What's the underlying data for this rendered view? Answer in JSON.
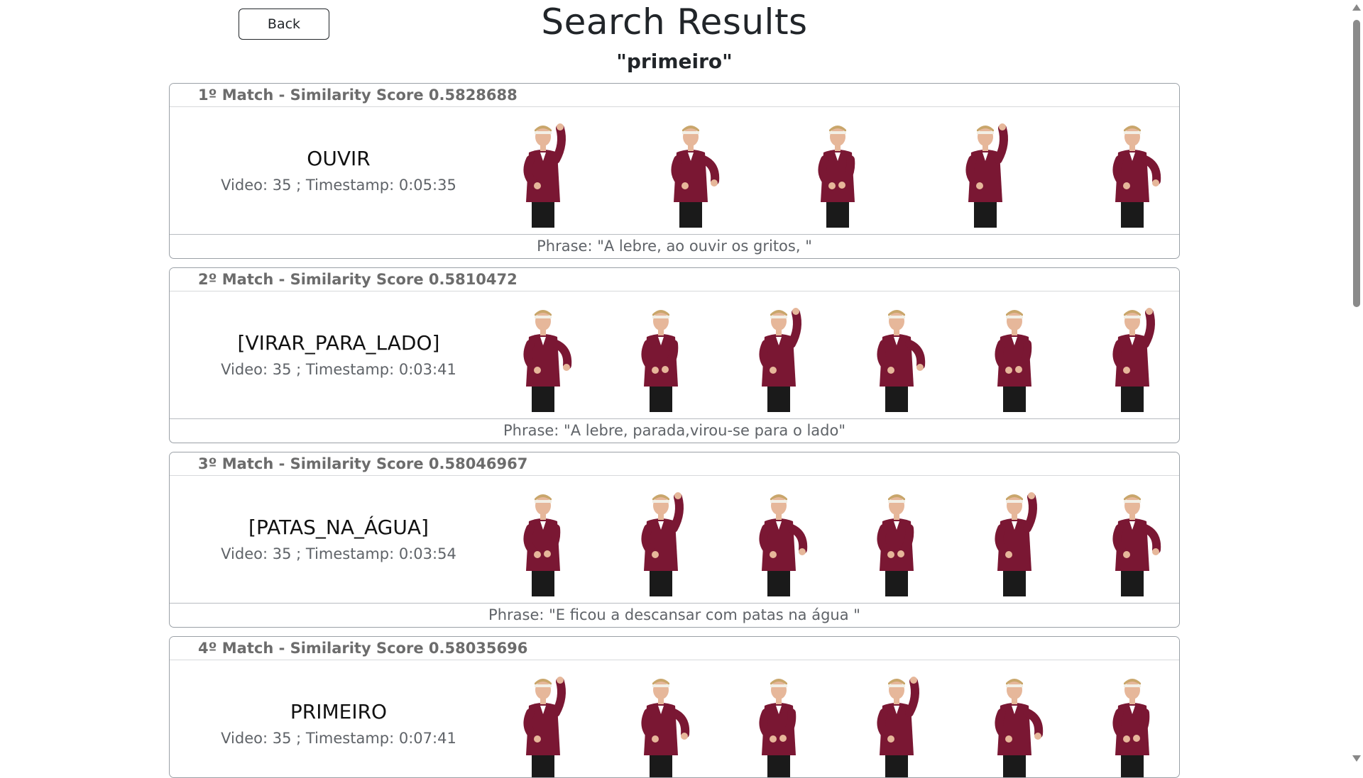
{
  "header": {
    "back_label": "Back",
    "title": "Search Results",
    "query": "\"primeiro\""
  },
  "results": [
    {
      "header": "1º Match - Similarity Score 0.5828688",
      "word": "OUVIR",
      "meta": "Video: 35 ; Timestamp: 0:05:35",
      "phrase": "Phrase: \"A lebre, ao ouvir os gritos, \"",
      "frame_count": 5
    },
    {
      "header": "2º Match - Similarity Score 0.5810472",
      "word": "[VIRAR_PARA_LADO]",
      "meta": "Video: 35 ; Timestamp: 0:03:41",
      "phrase": "Phrase: \"A lebre, parada,virou-se para o lado\"",
      "frame_count": 6
    },
    {
      "header": "3º Match - Similarity Score 0.58046967",
      "word": "[PATAS_NA_ÁGUA]",
      "meta": "Video: 35 ; Timestamp: 0:03:54",
      "phrase": "Phrase: \"E ficou a descansar com patas na água \"",
      "frame_count": 6
    },
    {
      "header": "4º Match - Similarity Score 0.58035696",
      "word": "PRIMEIRO",
      "meta": "Video: 35 ; Timestamp: 0:07:41",
      "phrase": "",
      "frame_count": 6
    }
  ],
  "colors": {
    "jacket": "#7a1733",
    "skin": "#e6b79a",
    "hair": "#c9a66b",
    "pants": "#1a1a1a"
  }
}
